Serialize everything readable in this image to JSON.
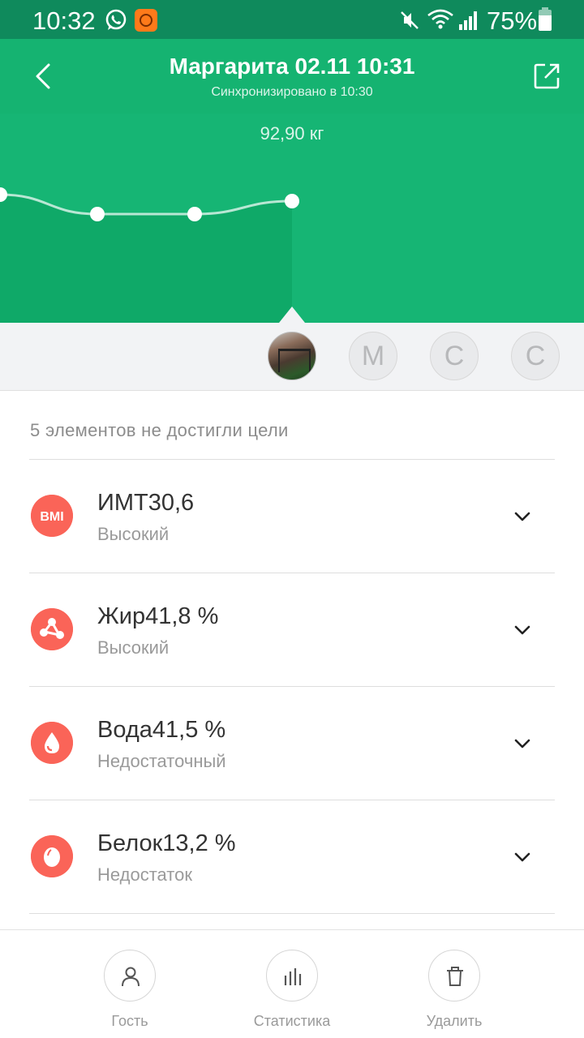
{
  "status_bar": {
    "time": "10:32",
    "battery": "75%",
    "icons": [
      "whatsapp-icon",
      "app-notification-icon",
      "mute-icon",
      "wifi-icon",
      "signal-icon",
      "battery-icon"
    ]
  },
  "header": {
    "title": "Маргарита 02.11 10:31",
    "subtitle": "Синхронизировано в 10:30",
    "back_icon": "back-arrow-icon",
    "share_icon": "share-icon",
    "background": "#15b371"
  },
  "chart": {
    "value_label": "92,90 кг",
    "accent": "#16b574"
  },
  "chart_data": {
    "type": "line",
    "series": [
      {
        "values": [
          93.0,
          92.7,
          92.7,
          92.9
        ]
      }
    ],
    "selected_index": 3
  },
  "avatars": [
    {
      "type": "photo",
      "letter": ""
    },
    {
      "type": "letter",
      "letter": "М"
    },
    {
      "type": "letter",
      "letter": "С"
    },
    {
      "type": "letter",
      "letter": "С"
    }
  ],
  "content": {
    "goal_note": "5 элементов не достигли цели",
    "metrics": [
      {
        "name": "ИМТ30,6",
        "status": "Высокий",
        "icon": "bmi-icon",
        "icon_text": "BMI"
      },
      {
        "name": "Жир41,8 %",
        "status": "Высокий",
        "icon": "fat-molecule-icon",
        "icon_text": ""
      },
      {
        "name": "Вода41,5 %",
        "status": "Недостаточный",
        "icon": "water-drop-icon",
        "icon_text": ""
      },
      {
        "name": "Белок13,2 %",
        "status": "Недостаток",
        "icon": "protein-egg-icon",
        "icon_text": ""
      }
    ],
    "alert_color": "#fa6458"
  },
  "bottom_nav": {
    "guest": "Гость",
    "stats": "Статистика",
    "delete": "Удалить"
  }
}
